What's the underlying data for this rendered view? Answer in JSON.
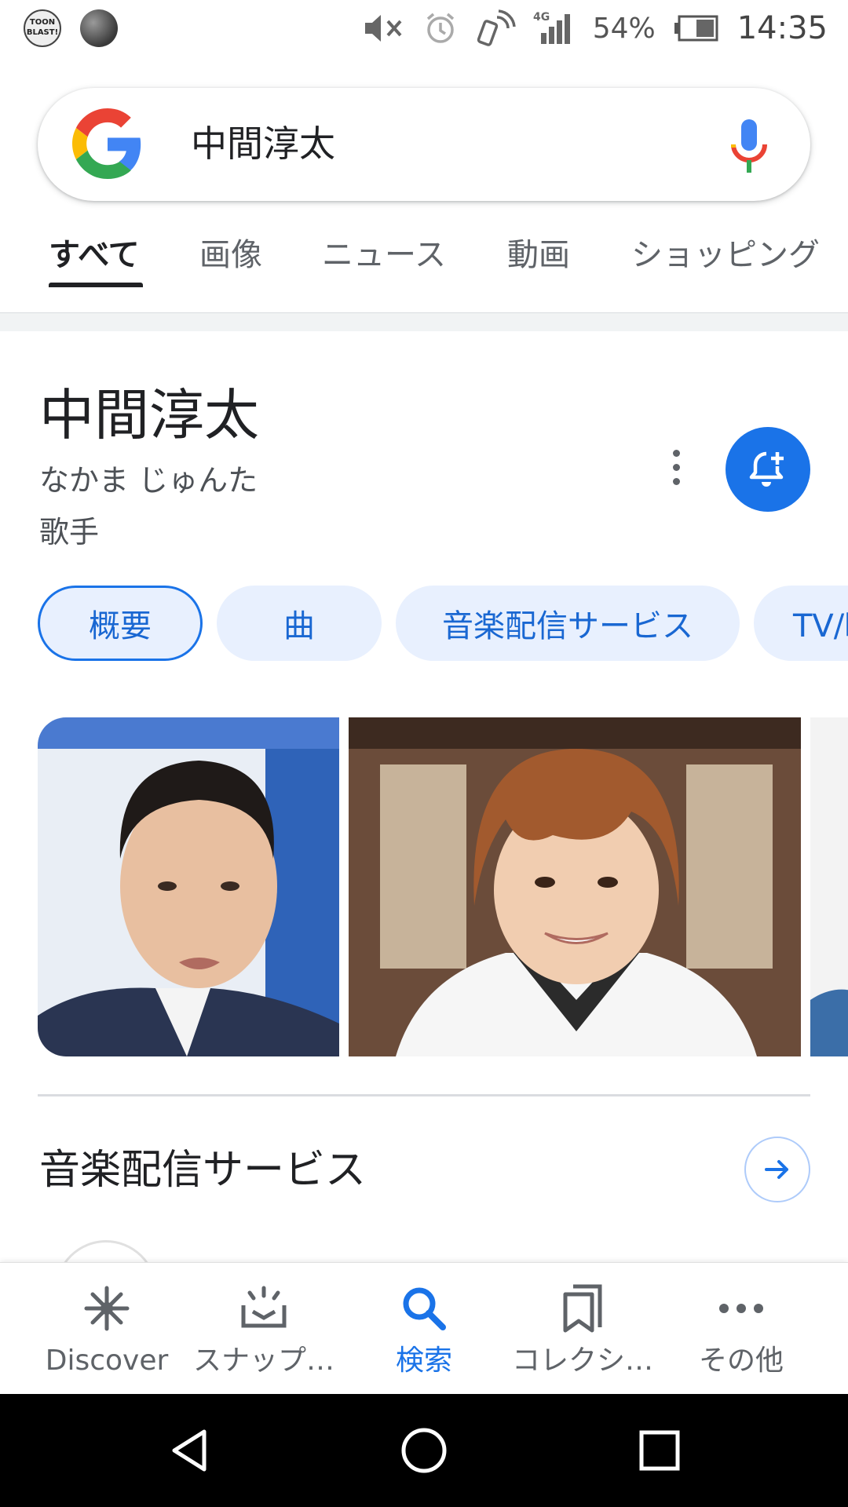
{
  "status_bar": {
    "app_icon_1": "TOON BLAST!",
    "battery": "54%",
    "time": "14:35",
    "network": "4G"
  },
  "search": {
    "query": "中間淳太"
  },
  "tabs": [
    "すべて",
    "画像",
    "ニュース",
    "動画",
    "ショッピング"
  ],
  "knowledge_panel": {
    "title": "中間淳太",
    "reading": "なかま じゅんた",
    "type": "歌手",
    "chips": [
      "概要",
      "曲",
      "音楽配信サービス",
      "TV/映"
    ],
    "section_title": "音楽配信サービス"
  },
  "bottom_nav": {
    "items": [
      "Discover",
      "スナップ…",
      "検索",
      "コレクシ…",
      "その他"
    ]
  },
  "colors": {
    "accent": "#1a73e8",
    "chip_bg": "#e8f0fe"
  }
}
